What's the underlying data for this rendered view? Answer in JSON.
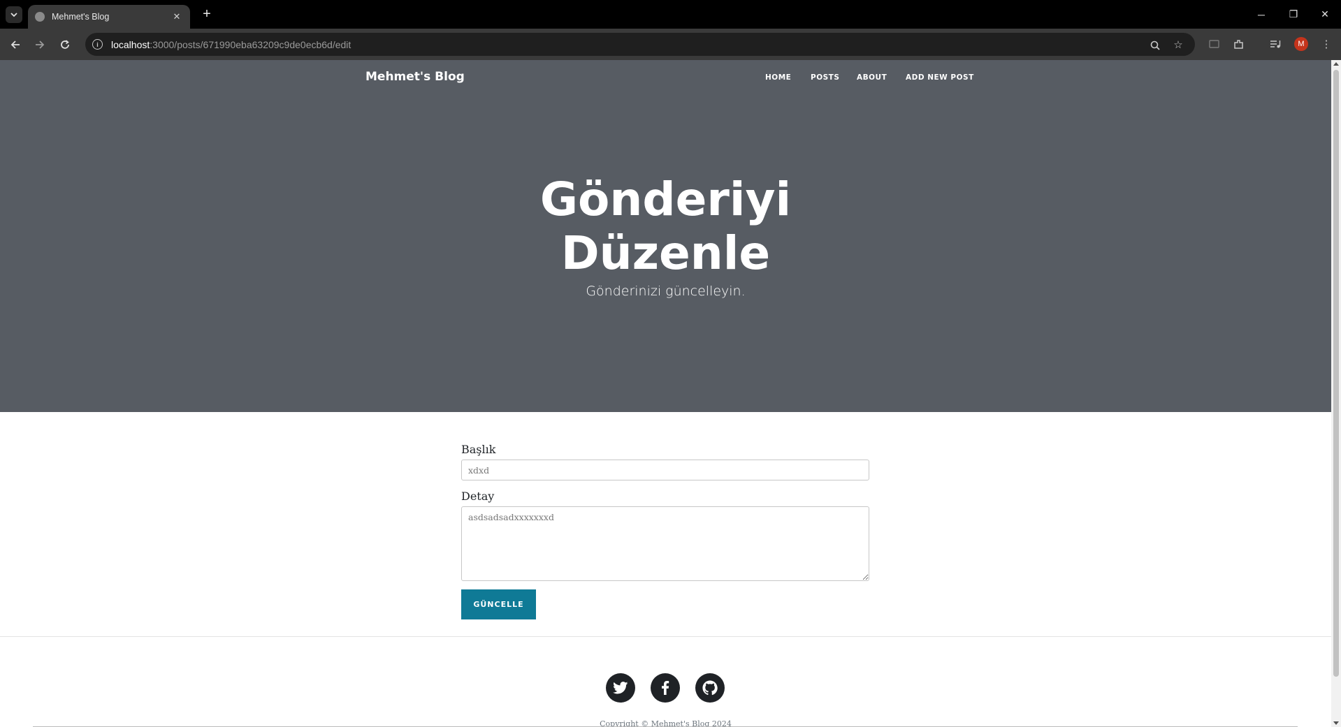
{
  "browser": {
    "tab_title": "Mehmet's Blog",
    "url_host": "localhost",
    "url_path": ":3000/posts/671990eba63209c9de0ecb6d/edit",
    "avatar_letter": "M"
  },
  "site": {
    "brand": "Mehmet's Blog",
    "nav": [
      "HOME",
      "POSTS",
      "ABOUT",
      "ADD NEW POST"
    ]
  },
  "hero": {
    "title_line1": "Gönderiyi",
    "title_line2": "Düzenle",
    "subtitle": "Gönderinizi güncelleyin."
  },
  "form": {
    "title_label": "Başlık",
    "title_value": "xdxd",
    "detail_label": "Detay",
    "detail_value": "asdsadsadxxxxxxxd",
    "submit_label": "GÜNCELLE"
  },
  "footer": {
    "copyright": "Copyright © Mehmet's Blog 2024",
    "social": [
      "twitter-icon",
      "facebook-icon",
      "github-icon"
    ]
  },
  "colors": {
    "masthead": "#575c63",
    "button": "#0f7a96"
  }
}
